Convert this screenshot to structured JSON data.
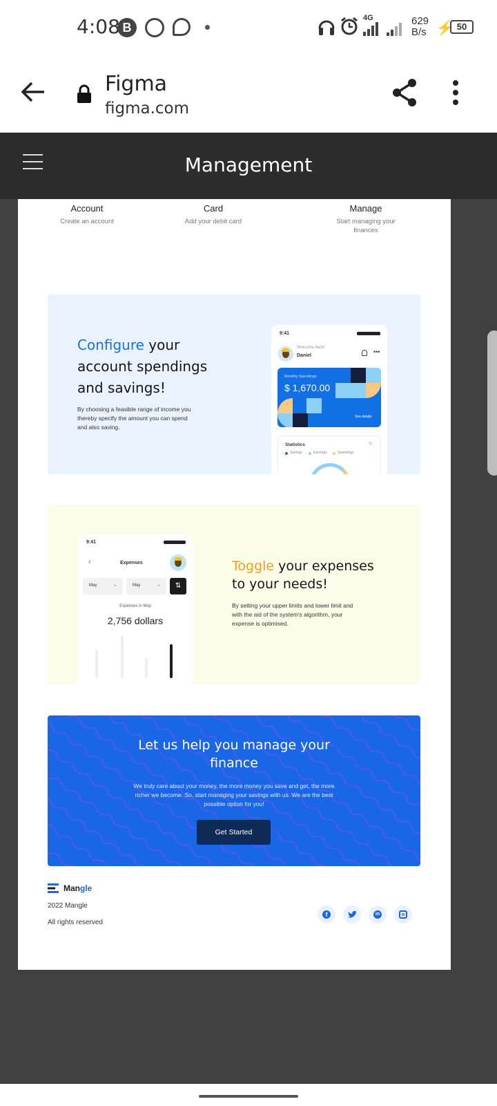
{
  "status_bar": {
    "time": "4:08",
    "network_speed_value": "629",
    "network_speed_unit": "B/s",
    "network_type": "4G",
    "battery": "50"
  },
  "browser": {
    "title": "Figma",
    "url": "figma.com"
  },
  "figma": {
    "frame_title": "Management"
  },
  "steps": [
    {
      "title": "Account",
      "subtitle": "Create an account"
    },
    {
      "title": "Card",
      "subtitle": "Add your debit card"
    },
    {
      "title": "Manage",
      "subtitle_line1": "Start managing your",
      "subtitle_line2": "finances"
    }
  ],
  "configure": {
    "highlight": "Configure",
    "heading_rest": " your",
    "heading_line2": "account spendings",
    "heading_line3": "and savings!",
    "body_line1": "By choosing a feasible range of income you",
    "body_line2": "thereby specify the amount you can spend",
    "body_line3": "and also saving.",
    "highlight_color": "#1a6ee6",
    "phone": {
      "time": "9:41",
      "welcome": "Welcome back!",
      "user": "Daniel",
      "card_label": "Monthly Spendings",
      "card_amount": "$ 1,670.00",
      "card_link": "See details",
      "stats_title": "Statistics",
      "legend": [
        "Savings",
        "Earnings",
        "Spendings"
      ]
    }
  },
  "toggle": {
    "highlight": "Toggle",
    "heading_rest": " your expenses",
    "heading_line2": "to your needs!",
    "body_line1": "By setting your upper limits and lower limit and",
    "body_line2": "with the aid of the system's algorithm, your",
    "body_line3": "expense is optimised.",
    "highlight_color": "#f59d1b",
    "phone": {
      "time": "9:41",
      "title": "Expenses",
      "select1": "May",
      "select2": "May",
      "caption": "Expenses in May",
      "amount": "2,756 dollars"
    }
  },
  "cta": {
    "title_line1": "Let us help you manage your",
    "title_line2": "finance",
    "body_line1": "We truly care about your money, the more money you save and get, the more",
    "body_line2": "richer we become. So, start managing your savings with us. We are the best",
    "body_line3": "possible option for you!",
    "button": "Get Started",
    "bg_color": "#1967e6"
  },
  "footer": {
    "brand_part1": "Man",
    "brand_part2": "gle",
    "copyright": "2022 Mangle",
    "rights": "All rights reserved",
    "socials": [
      "facebook-icon",
      "twitter-icon",
      "linkedin-icon",
      "instagram-icon"
    ]
  }
}
